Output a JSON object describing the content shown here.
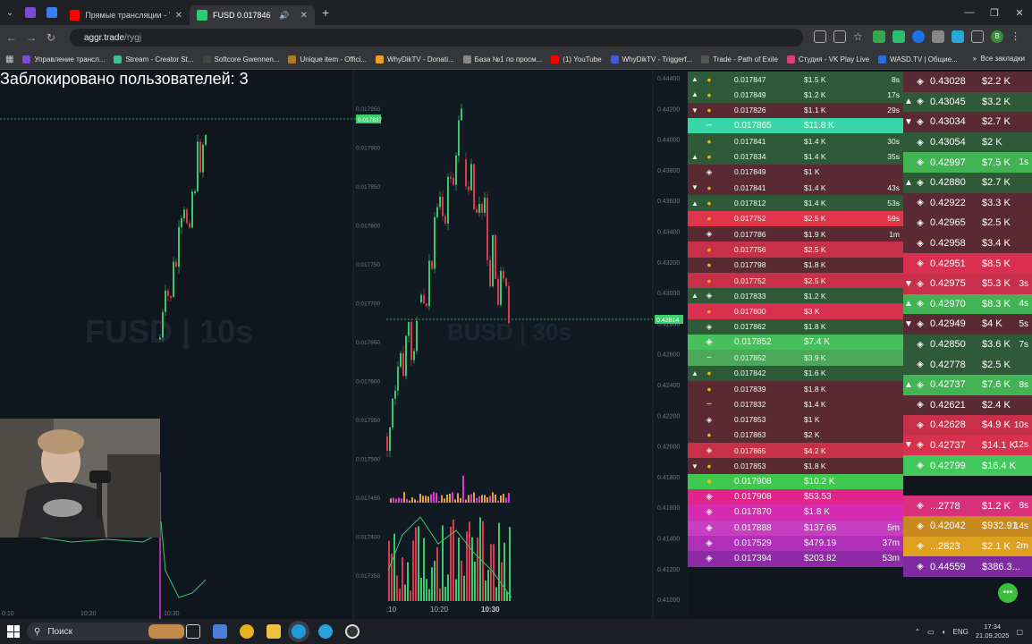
{
  "browser": {
    "tabs": [
      {
        "title": "Прямые трансляции - YouTube",
        "active": false
      },
      {
        "title": "FUSD 0.017846",
        "active": true
      }
    ],
    "new_tab": "+",
    "url_host": "aggr.trade",
    "url_path": "/rygj",
    "bookmarks": [
      "Управление трансл...",
      "Stream - Creator St...",
      "Softcore Gwennen...",
      "Unique item - Offici...",
      "WhyDikTV - Donati...",
      "База №1 по просм...",
      "(1) YouTube",
      "WhyDikTV - Triggerf...",
      "Trade - Path of Exile",
      "Студия - VK Play Live",
      "WASD.TV | Общие..."
    ],
    "all_bookmarks": "Все закладки",
    "profile_initial": "B"
  },
  "overlay": {
    "blocked_users": "Заблокировано пользователей: 3"
  },
  "chart_left": {
    "watermark": "FUSD | 10s",
    "price_ticks": [
      "0.017950",
      "0.017900",
      "0.017850",
      "0.017800",
      "0.017750",
      "0.017700",
      "0.017650",
      "0.017600",
      "0.017550",
      "0.017500",
      "0.017450",
      "0.017400",
      "0.017350"
    ],
    "price_label": "0.017837",
    "time_ticks": [
      "0:10",
      "10:20",
      "10:30"
    ]
  },
  "chart_right": {
    "watermark": "BUSD | 30s",
    "price_ticks": [
      "0.44400",
      "0.44200",
      "0.44000",
      "0.43800",
      "0.43600",
      "0.43400",
      "0.43200",
      "0.43000",
      "0.42800",
      "0.42600",
      "0.42400",
      "0.42200",
      "0.42000",
      "0.41800",
      "0.41600",
      "0.41400",
      "0.41200",
      "0.41000"
    ],
    "price_label": "0.42814",
    "time_ticks": [
      ":10",
      "10:20",
      "10:30"
    ]
  },
  "colors": {
    "buy": "#4caf50",
    "sell": "#e0354b",
    "accent": "#2ecc71"
  },
  "trades_small": [
    {
      "arrow": "▲",
      "ex": "coin",
      "price": "0.017847",
      "amount": "$1.5 K",
      "age": "8s",
      "bg": "#2f5a38"
    },
    {
      "arrow": "▲",
      "ex": "coin",
      "price": "0.017849",
      "amount": "$1.2 K",
      "age": "17s",
      "bg": "#2f5a38"
    },
    {
      "arrow": "▼",
      "ex": "coin",
      "price": "0.017826",
      "amount": "$1.1 K",
      "age": "29s",
      "bg": "#5a2a34"
    },
    {
      "arrow": "",
      "ex": "bybit",
      "price": "0.017865",
      "amount": "$11.8 K",
      "age": "",
      "bg": "#3ad6a8"
    },
    {
      "arrow": "",
      "ex": "coin",
      "price": "0.017841",
      "amount": "$1.4 K",
      "age": "30s",
      "bg": "#2f5a38"
    },
    {
      "arrow": "▲",
      "ex": "coin",
      "price": "0.017834",
      "amount": "$1.4 K",
      "age": "35s",
      "bg": "#2f5a38"
    },
    {
      "arrow": "",
      "ex": "binance",
      "price": "0.017849",
      "amount": "$1 K",
      "age": "",
      "bg": "#5a2a34"
    },
    {
      "arrow": "▼",
      "ex": "coin",
      "price": "0.017841",
      "amount": "$1.4 K",
      "age": "43s",
      "bg": "#5a2a34"
    },
    {
      "arrow": "▲",
      "ex": "coin",
      "price": "0.017812",
      "amount": "$1.4 K",
      "age": "53s",
      "bg": "#2f5a38"
    },
    {
      "arrow": "",
      "ex": "coin",
      "price": "0.017752",
      "amount": "$2.5 K",
      "age": "59s",
      "bg": "#e0354b"
    },
    {
      "arrow": "",
      "ex": "binance",
      "price": "0.017786",
      "amount": "$1.9 K",
      "age": "1m",
      "bg": "#5a2a34"
    },
    {
      "arrow": "",
      "ex": "coin",
      "price": "0.017756",
      "amount": "$2.5 K",
      "age": "",
      "bg": "#c8304a"
    },
    {
      "arrow": "",
      "ex": "coin",
      "price": "0.017798",
      "amount": "$1.8 K",
      "age": "",
      "bg": "#5a2a34"
    },
    {
      "arrow": "",
      "ex": "coin",
      "price": "0.017752",
      "amount": "$2.5 K",
      "age": "",
      "bg": "#c8304a"
    },
    {
      "arrow": "▲",
      "ex": "binance",
      "price": "0.017833",
      "amount": "$1.2 K",
      "age": "",
      "bg": "#2f5a38"
    },
    {
      "arrow": "",
      "ex": "coin",
      "price": "0.017800",
      "amount": "$3 K",
      "age": "",
      "bg": "#d8304e"
    },
    {
      "arrow": "",
      "ex": "binance",
      "price": "0.017862",
      "amount": "$1.8 K",
      "age": "",
      "bg": "#2f5a38"
    },
    {
      "arrow": "",
      "ex": "binance",
      "price": "0.017852",
      "amount": "$7.4 K",
      "age": "",
      "bg": "#46c05a"
    },
    {
      "arrow": "",
      "ex": "bybit",
      "price": "0.017852",
      "amount": "$3.9 K",
      "age": "",
      "bg": "#4aa85a"
    },
    {
      "arrow": "▲",
      "ex": "coin",
      "price": "0.017842",
      "amount": "$1.6 K",
      "age": "",
      "bg": "#2f5a38"
    },
    {
      "arrow": "",
      "ex": "coin",
      "price": "0.017839",
      "amount": "$1.8 K",
      "age": "",
      "bg": "#5a2a34"
    },
    {
      "arrow": "",
      "ex": "bybit",
      "price": "0.017832",
      "amount": "$1.4 K",
      "age": "",
      "bg": "#5a2a34"
    },
    {
      "arrow": "",
      "ex": "binance",
      "price": "0.017853",
      "amount": "$1 K",
      "age": "",
      "bg": "#5a2a34"
    },
    {
      "arrow": "",
      "ex": "coin",
      "price": "0.017863",
      "amount": "$2 K",
      "age": "",
      "bg": "#5a2a34"
    },
    {
      "arrow": "",
      "ex": "binance",
      "price": "0.017865",
      "amount": "$4.2 K",
      "age": "",
      "bg": "#c8304a"
    },
    {
      "arrow": "▼",
      "ex": "coin",
      "price": "0.017853",
      "amount": "$1.8 K",
      "age": "",
      "bg": "#5a2a34"
    },
    {
      "arrow": "",
      "ex": "coin",
      "price": "0.017908",
      "amount": "$10.2 K",
      "age": "",
      "bg": "#3ec84e"
    },
    {
      "arrow": "",
      "ex": "binance",
      "price": "0.017908",
      "amount": "$53.53",
      "age": "",
      "bg": "#e0248a"
    },
    {
      "arrow": "",
      "ex": "binance",
      "price": "0.017870",
      "amount": "$1.8 K",
      "age": "",
      "bg": "#d62bb0"
    },
    {
      "arrow": "",
      "ex": "binance",
      "price": "0.017888",
      "amount": "$137.65",
      "age": "5m",
      "bg": "#c83ec0"
    },
    {
      "arrow": "",
      "ex": "binance",
      "price": "0.017529",
      "amount": "$479.19",
      "age": "37m",
      "bg": "#b02fb8"
    },
    {
      "arrow": "",
      "ex": "binance",
      "price": "0.017394",
      "amount": "$203.82",
      "age": "53m",
      "bg": "#8e2aa6"
    }
  ],
  "trades_big": [
    {
      "arrow": "",
      "price": "0.43028",
      "amount": "$2.2 K",
      "age": "",
      "bg": "#5a2a34"
    },
    {
      "arrow": "▲",
      "price": "0.43045",
      "amount": "$3.2 K",
      "age": "",
      "bg": "#2f5a38"
    },
    {
      "arrow": "▼",
      "price": "0.43034",
      "amount": "$2.7 K",
      "age": "",
      "bg": "#5a2a34"
    },
    {
      "arrow": "",
      "price": "0.43054",
      "amount": "$2 K",
      "age": "",
      "bg": "#2f5a38"
    },
    {
      "arrow": "",
      "price": "0.42997",
      "amount": "$7.5 K",
      "age": "1s",
      "bg": "#42b454"
    },
    {
      "arrow": "▲",
      "price": "0.42880",
      "amount": "$2.7 K",
      "age": "",
      "bg": "#2f5a38"
    },
    {
      "arrow": "",
      "price": "0.42922",
      "amount": "$3.3 K",
      "age": "",
      "bg": "#5a2a34"
    },
    {
      "arrow": "",
      "price": "0.42965",
      "amount": "$2.5 K",
      "age": "",
      "bg": "#5a2a34"
    },
    {
      "arrow": "",
      "price": "0.42958",
      "amount": "$3.4 K",
      "age": "",
      "bg": "#5a2a34"
    },
    {
      "arrow": "",
      "price": "0.42951",
      "amount": "$8.5 K",
      "age": "",
      "bg": "#d8304e"
    },
    {
      "arrow": "▼",
      "price": "0.42975",
      "amount": "$5.3 K",
      "age": "3s",
      "bg": "#c8304a"
    },
    {
      "arrow": "▲",
      "price": "0.42970",
      "amount": "$8.3 K",
      "age": "4s",
      "bg": "#42b454"
    },
    {
      "arrow": "▼",
      "price": "0.42949",
      "amount": "$4 K",
      "age": "5s",
      "bg": "#5a2a34"
    },
    {
      "arrow": "",
      "price": "0.42850",
      "amount": "$3.6 K",
      "age": "7s",
      "bg": "#2f5a38"
    },
    {
      "arrow": "",
      "price": "0.42778",
      "amount": "$2.5 K",
      "age": "",
      "bg": "#2f5a38"
    },
    {
      "arrow": "▲",
      "price": "0.42737",
      "amount": "$7.6 K",
      "age": "8s",
      "bg": "#42b454"
    },
    {
      "arrow": "",
      "price": "0.42621",
      "amount": "$2.4 K",
      "age": "",
      "bg": "#5a2a34"
    },
    {
      "arrow": "",
      "price": "0.42628",
      "amount": "$4.9 K",
      "age": "10s",
      "bg": "#c8304a"
    },
    {
      "arrow": "▼",
      "price": "0.42737",
      "amount": "$14.1 K",
      "age": "12s",
      "bg": "#d8304e"
    },
    {
      "arrow": "",
      "price": "0.42799",
      "amount": "$16.4 K",
      "age": "",
      "bg": "#42c85a"
    },
    {
      "arrow": "",
      "price": "",
      "amount": "",
      "age": "",
      "bg": "#0f161e"
    },
    {
      "arrow": "",
      "price": "...2778",
      "amount": "$1.2 K",
      "age": "8s",
      "bg": "#d8307a"
    },
    {
      "arrow": "",
      "price": "0.42042",
      "amount": "$932.91",
      "age": "14s",
      "bg": "#c88a1e"
    },
    {
      "arrow": "",
      "price": "...2823",
      "amount": "$2.1 K",
      "age": "2m",
      "bg": "#e0a020"
    },
    {
      "arrow": "",
      "price": "0.44559",
      "amount": "$386.3...",
      "age": "",
      "bg": "#7e2aa0"
    }
  ],
  "taskbar": {
    "search_label": "Поиск",
    "lang": "ENG",
    "time": "17:34",
    "date": "21.09.2025"
  }
}
